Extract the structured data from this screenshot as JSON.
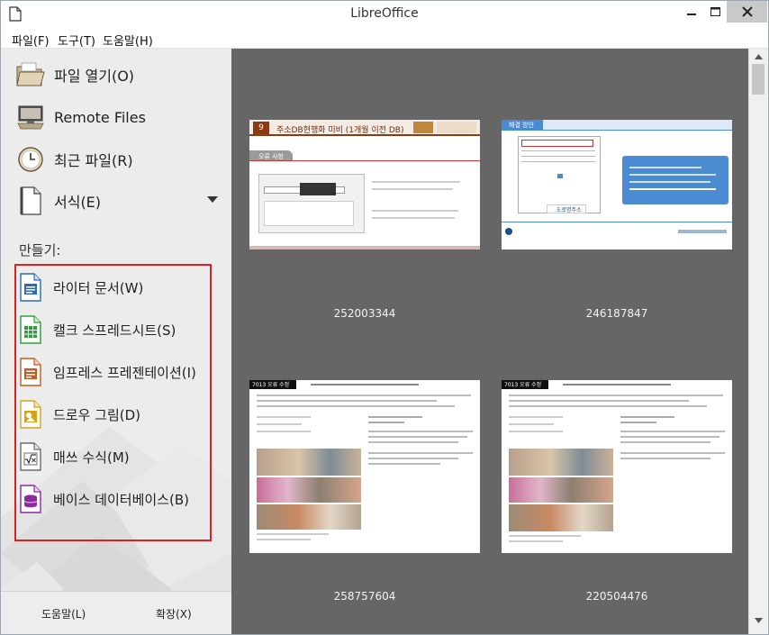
{
  "window": {
    "title": "LibreOffice"
  },
  "menubar": {
    "items": [
      "파일(F)",
      "도구(T)",
      "도움말(H)"
    ]
  },
  "sidebar": {
    "commands": [
      {
        "label": "파일 열기(O)",
        "icon": "open-folder-icon"
      },
      {
        "label": "Remote Files",
        "icon": "remote-files-icon"
      },
      {
        "label": "최근 파일(R)",
        "icon": "recent-files-clock-icon"
      },
      {
        "label": "서식(E)",
        "icon": "templates-document-icon"
      }
    ],
    "create_heading": "만들기:",
    "create_items": [
      {
        "label": "라이터 문서(W)",
        "icon": "writer-document-icon",
        "color": "#2a6db5"
      },
      {
        "label": "캘크 스프레드시트(S)",
        "icon": "calc-spreadsheet-icon",
        "color": "#2e9e3a"
      },
      {
        "label": "임프레스 프레젠테이션(I)",
        "icon": "impress-presentation-icon",
        "color": "#c8591c"
      },
      {
        "label": "드로우 그림(D)",
        "icon": "draw-drawing-icon",
        "color": "#d6a21b"
      },
      {
        "label": "매쓰 수식(M)",
        "icon": "math-formula-icon",
        "color": "#6b6b6b"
      },
      {
        "label": "베이스 데이터베이스(B)",
        "icon": "base-database-icon",
        "color": "#8a2c9c"
      }
    ],
    "footer": {
      "help": "도움말(L)",
      "extensions": "확장(X)"
    },
    "highlight_color": "#e02020"
  },
  "recent_documents": [
    {
      "caption": "252003344",
      "slide_number": "9",
      "slide_title": "주소DB현행화 미비 (1개월 이전 DB)",
      "tag": "오류 사항"
    },
    {
      "caption": "246187847",
      "slide_title": "해결 방안",
      "logo_text": "도로명주소"
    },
    {
      "caption": "258757604",
      "doc_heading": "7013 오류 수정"
    },
    {
      "caption": "220504476",
      "doc_heading": "7013 오류 수정"
    }
  ],
  "colors": {
    "main_background": "#666666",
    "sidebar_background": "#ececec",
    "impress_accent": "#8b3a13",
    "slide_blue": "#4a8bd1"
  }
}
